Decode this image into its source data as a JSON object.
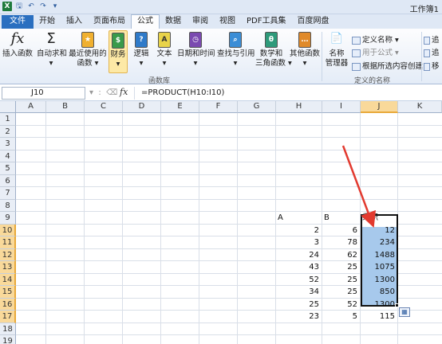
{
  "window": {
    "title": "工作簿1"
  },
  "tabs": [
    "文件",
    "开始",
    "插入",
    "页面布局",
    "公式",
    "数据",
    "审阅",
    "视图",
    "PDF工具集",
    "百度网盘"
  ],
  "ribbon": {
    "insert_function": "插入函数",
    "autosum": "自动求和",
    "recent_line1": "最近使用的",
    "recent_line2": "函数",
    "financial": "财务",
    "logical": "逻辑",
    "text": "文本",
    "datetime": "日期和时间",
    "lookup": "查找与引用",
    "math_line1": "数学和",
    "math_line2": "三角函数",
    "other": "其他函数",
    "name_mgr_line1": "名称",
    "name_mgr_line2": "管理器",
    "define_name": "定义名称",
    "use_in_formula": "用于公式",
    "create_from_sel": "根据所选内容创建",
    "group_function_library": "函数库",
    "group_defined_names": "定义的名称",
    "trace1": "追",
    "trace2": "追",
    "trace3": "移"
  },
  "formula_bar": {
    "name_box": "J10",
    "fx": "fx",
    "formula": "=PRODUCT(H10:I10)"
  },
  "columns": [
    "A",
    "B",
    "C",
    "D",
    "E",
    "F",
    "G",
    "H",
    "I",
    "J",
    "K"
  ],
  "rows": [
    "1",
    "2",
    "3",
    "4",
    "5",
    "6",
    "7",
    "8",
    "9",
    "10",
    "11",
    "12",
    "13",
    "14",
    "15",
    "16",
    "17",
    "18",
    "19",
    "20"
  ],
  "headers_row9": {
    "H": "A",
    "I": "B",
    "J": "乘积"
  },
  "data": [
    {
      "row": "10",
      "H": "2",
      "I": "6",
      "J": "12"
    },
    {
      "row": "11",
      "H": "3",
      "I": "78",
      "J": "234"
    },
    {
      "row": "12",
      "H": "24",
      "I": "62",
      "J": "1488"
    },
    {
      "row": "13",
      "H": "43",
      "I": "25",
      "J": "1075"
    },
    {
      "row": "14",
      "H": "52",
      "I": "25",
      "J": "1300"
    },
    {
      "row": "15",
      "H": "34",
      "I": "25",
      "J": "850"
    },
    {
      "row": "16",
      "H": "25",
      "I": "52",
      "J": "1300"
    },
    {
      "row": "17",
      "H": "23",
      "I": "5",
      "J": "115"
    }
  ],
  "colors": {
    "selection_fill": "#a7c9ec",
    "header_highlight": "#f9d99a",
    "arrow": "#e23a2f"
  }
}
